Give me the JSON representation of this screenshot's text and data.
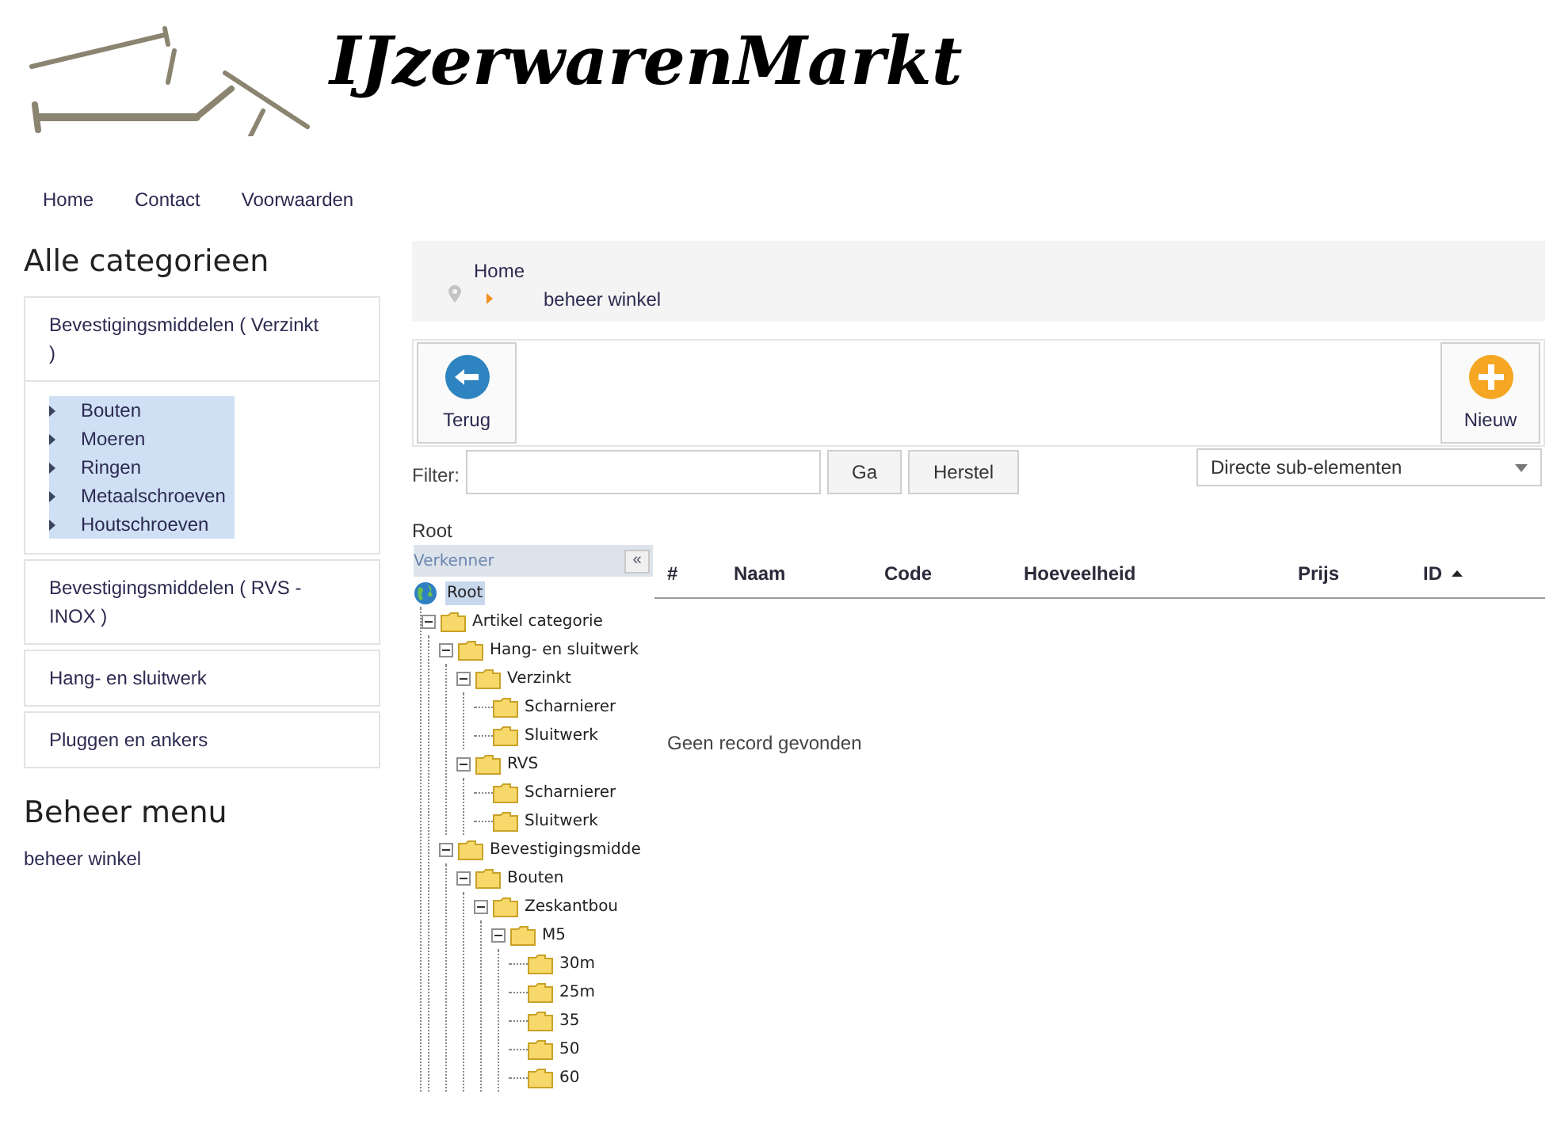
{
  "header": {
    "title": "IJzerwarenMarkt"
  },
  "nav": [
    "Home",
    "Contact",
    "Voorwaarden"
  ],
  "sidebar": {
    "title": "Alle categorieen",
    "categories": [
      {
        "label": "Bevestigingsmiddelen ( Verzinkt )",
        "subitems": [
          {
            "label": "Bouten",
            "highlighted": true
          },
          {
            "label": "Moeren",
            "highlighted": true
          },
          {
            "label": "Ringen",
            "highlighted": true
          },
          {
            "label": "Metaalschroeven",
            "highlighted": true
          },
          {
            "label": "Houtschroeven",
            "highlighted": true
          }
        ]
      },
      {
        "label": "Bevestigingsmiddelen ( RVS - INOX )"
      },
      {
        "label": "Hang- en sluitwerk"
      },
      {
        "label": "Pluggen en ankers"
      }
    ],
    "admin_title": "Beheer menu",
    "admin_link": "beheer winkel"
  },
  "breadcrumb": [
    "Home",
    "beheer winkel"
  ],
  "toolbar": [
    {
      "label": "Terug",
      "kind": "back"
    },
    {
      "label": "Nieuw",
      "kind": "new"
    }
  ],
  "filter": {
    "label": "Filter:",
    "go": "Ga",
    "reset": "Herstel",
    "scope": "Directe sub-elementen"
  },
  "current_node": "Root",
  "explorer": {
    "title": "Verkenner",
    "collapse": "«",
    "tree": [
      {
        "label": "Root",
        "kind": "root",
        "selected": true,
        "children": [
          {
            "label": "Artikel categorie",
            "selected": false,
            "expanded": true,
            "children": [
              {
                "label": "Hang- en sluitwerk",
                "selected": false,
                "expanded": true,
                "children": [
                  {
                    "label": "Verzinkt",
                    "selected": false,
                    "expanded": true,
                    "children": [
                      {
                        "label": "Scharnierer",
                        "selected": false
                      },
                      {
                        "label": "Sluitwerk",
                        "selected": false
                      }
                    ]
                  },
                  {
                    "label": "RVS",
                    "selected": false,
                    "expanded": true,
                    "children": [
                      {
                        "label": "Scharnierer",
                        "selected": false
                      },
                      {
                        "label": "Sluitwerk",
                        "selected": false
                      }
                    ]
                  }
                ]
              },
              {
                "label": "Bevestigingsmidde",
                "selected": false,
                "expanded": true,
                "children": [
                  {
                    "label": "Bouten",
                    "selected": false,
                    "expanded": true,
                    "children": [
                      {
                        "label": "Zeskantbou",
                        "selected": false,
                        "expanded": true,
                        "children": [
                          {
                            "label": "M5",
                            "selected": false,
                            "expanded": true,
                            "children": [
                              {
                                "label": "30m",
                                "selected": false
                              },
                              {
                                "label": "25m",
                                "selected": false
                              },
                              {
                                "label": "35",
                                "selected": false
                              },
                              {
                                "label": "50",
                                "selected": false
                              },
                              {
                                "label": "60",
                                "selected": false
                              }
                            ]
                          }
                        ]
                      }
                    ]
                  }
                ]
              }
            ]
          }
        ]
      }
    ]
  },
  "table": {
    "columns": [
      {
        "label": "#",
        "sorted": false
      },
      {
        "label": "Naam",
        "sorted": false
      },
      {
        "label": "Code",
        "sorted": false
      },
      {
        "label": "Hoeveelheid",
        "sorted": false
      },
      {
        "label": "Prijs",
        "sorted": false
      },
      {
        "label": "ID",
        "sorted": true
      }
    ],
    "empty": "Geen record gevonden"
  }
}
